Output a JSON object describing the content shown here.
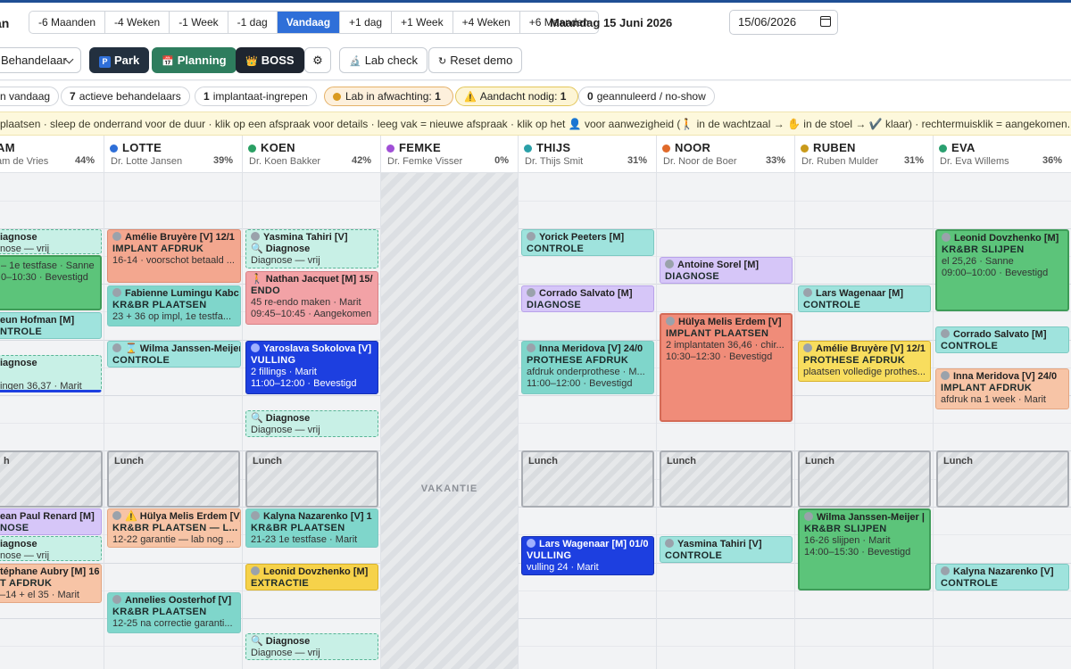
{
  "toolbar": {
    "title": "an",
    "nav": [
      "-6 Maanden",
      "-4 Weken",
      "-1 Week",
      "-1 dag",
      "Vandaag",
      "+1 dag",
      "+1 Week",
      "+4 Weken",
      "+6 Maanden"
    ],
    "date_label": "Maandag 15 Juni 2026",
    "date_value": "15/06/2026"
  },
  "toolbar2": {
    "select_value": "Behandelaar",
    "park": "Park",
    "planning": "Planning",
    "boss": "BOSS",
    "lab_check": "Lab check",
    "reset": "Reset demo"
  },
  "stats": {
    "s1": "n vandaag",
    "s2n": "7",
    "s2": "actieve behandelaars",
    "s3n": "1",
    "s3": "implantaat-ingrepen",
    "s4": "Lab in afwachting:",
    "s4n": "1",
    "s5": "Aandacht nodig:",
    "s5n": "1",
    "s6n": "0",
    "s6": "geannuleerd / no-show"
  },
  "hint": "rplaatsen · sleep de onderrand voor de duur · klik op een afspraak voor details · leeg vak = nieuwe afspraak · klik op het 👤 voor aanwezigheid (🚶 in de wachtzaal → ✋ in de stoel → ✔️ klaar) · rechtermuisklik = aangekomen.",
  "colors": {
    "lotte": "#2f6fd8",
    "koen": "#2aa064",
    "femke": "#a04fd6",
    "thijs": "#2aa0a8",
    "noor": "#e06a2a",
    "ruben": "#c99a1a",
    "eva": "#2aa070"
  },
  "columns": [
    {
      "name": "AM",
      "doc": "am de Vries",
      "pct": "44%"
    },
    {
      "name": "LOTTE",
      "doc": "Dr. Lotte Jansen",
      "pct": "39%"
    },
    {
      "name": "KOEN",
      "doc": "Dr. Koen Bakker",
      "pct": "42%"
    },
    {
      "name": "FEMKE",
      "doc": "Dr. Femke Visser",
      "pct": "0%"
    },
    {
      "name": "THIJS",
      "doc": "Dr. Thijs Smit",
      "pct": "31%"
    },
    {
      "name": "NOOR",
      "doc": "Dr. Noor de Boer",
      "pct": "33%"
    },
    {
      "name": "RUBEN",
      "doc": "Dr. Ruben Mulder",
      "pct": "31%"
    },
    {
      "name": "EVA",
      "doc": "Dr. Eva Willems",
      "pct": "36%"
    }
  ],
  "lunch_label": "Lunch",
  "lunch_label_cut": "h",
  "vacation": "VAKANTIE",
  "events": {
    "a1": {
      "n": "iagnose",
      "d": "nose — vrij"
    },
    "a2": {
      "d": "– 1e testfase · Sanne",
      "d2": "0–10:30 · Bevestigd"
    },
    "a3": {
      "n": "eun Hofman [M]",
      "t": "NTROLE"
    },
    "a4": {
      "n": "iagnose",
      "d": "ingen 36,37 · Marit"
    },
    "a5": {
      "n": "ean Paul Renard [M]",
      "t": "NOSE"
    },
    "a6": {
      "n": "iagnose",
      "d": "nose — vrij"
    },
    "a7": {
      "n": "téphane Aubry [M] 16",
      "t": "T AFDRUK",
      "d": "–14 + el 35 · Marit"
    },
    "l1": {
      "n": "Amélie Bruyère [V] 12/1",
      "t": "IMPLANT AFDRUK",
      "d": "16-14 · voorschot betaald ..."
    },
    "l2": {
      "n": "Fabienne Lumingu Kabc",
      "t": "KR&BR PLAATSEN",
      "d": "23 + 36 op impl, 1e testfa..."
    },
    "l3": {
      "n": "⌛ Wilma Janssen-Meijer",
      "t": "CONTROLE"
    },
    "l4": {
      "n": "⚠️ Hülya Melis Erdem [V]",
      "t": "KR&BR PLAATSEN — L...",
      "d": "12-22 garantie — lab nog ..."
    },
    "l5": {
      "n": "Annelies Oosterhof [V]",
      "t": "KR&BR PLAATSEN",
      "d": "12-25 na correctie garanti..."
    },
    "k1": {
      "n": "Yasmina Tahiri [V]"
    },
    "k2": {
      "n": "🔍 Diagnose",
      "d": "Diagnose — vrij"
    },
    "k3": {
      "n": "🚶 Nathan Jacquet [M] 15/",
      "t": "ENDO",
      "d": "45 re-endo maken · Marit",
      "d2": "09:45–10:45 · Aangekomen"
    },
    "k4": {
      "n": "Yaroslava Sokolova [V]",
      "t": "VULLING",
      "d": "2 fillings · Marit",
      "d2": "11:00–12:00 · Bevestigd"
    },
    "k5": {
      "n": "🔍 Diagnose",
      "d": "Diagnose — vrij"
    },
    "k6": {
      "n": "Kalyna Nazarenko [V] 1",
      "t": "KR&BR PLAATSEN",
      "d": "21-23 1e testfase · Marit"
    },
    "k7": {
      "n": "Leonid Dovzhenko [M]",
      "t": "EXTRACTIE"
    },
    "k8": {
      "n": "🔍 Diagnose",
      "d": "Diagnose — vrij"
    },
    "t1": {
      "n": "Yorick Peeters [M]",
      "t": "CONTROLE"
    },
    "t2": {
      "n": "Corrado Salvato [M]",
      "t": "DIAGNOSE"
    },
    "t3": {
      "n": "Inna Meridova [V] 24/0",
      "t": "PROTHESE AFDRUK",
      "d": "afdruk onderprothese · M...",
      "d2": "11:00–12:00 · Bevestigd"
    },
    "t4": {
      "n": "Lars Wagenaar [M] 01/0",
      "t": "VULLING",
      "d": "vulling 24 · Marit"
    },
    "n1": {
      "n": "Antoine Sorel [M]",
      "t": "DIAGNOSE"
    },
    "n2": {
      "n": "Hülya Melis Erdem [V]",
      "t": "IMPLANT PLAATSEN",
      "d": "2 implantaten 36,46 · chir...",
      "d2": "10:30–12:30 · Bevestigd"
    },
    "n3": {
      "n": "Yasmina Tahiri [V]",
      "t": "CONTROLE"
    },
    "r1": {
      "n": "Lars Wagenaar [M]",
      "t": "CONTROLE"
    },
    "r2": {
      "n": "Amélie Bruyère [V] 12/1",
      "t": "PROTHESE AFDRUK",
      "d": "plaatsen volledige prothes..."
    },
    "r3": {
      "n": "Wilma Janssen-Meijer |",
      "t": "KR&BR SLIJPEN",
      "d": "16-26 slijpen · Marit",
      "d2": "14:00–15:30 · Bevestigd"
    },
    "e1": {
      "n": "Leonid Dovzhenko [M]",
      "t": "KR&BR SLIJPEN",
      "d": "el 25,26 · Sanne",
      "d2": "09:00–10:00 · Bevestigd"
    },
    "e2": {
      "n": "Corrado Salvato [M]",
      "t": "CONTROLE"
    },
    "e3": {
      "n": "Inna Meridova [V] 24/0",
      "t": "IMPLANT AFDRUK",
      "d": "afdruk na 1 week · Marit"
    },
    "e4": {
      "n": "Kalyna Nazarenko [V]",
      "t": "CONTROLE"
    }
  }
}
